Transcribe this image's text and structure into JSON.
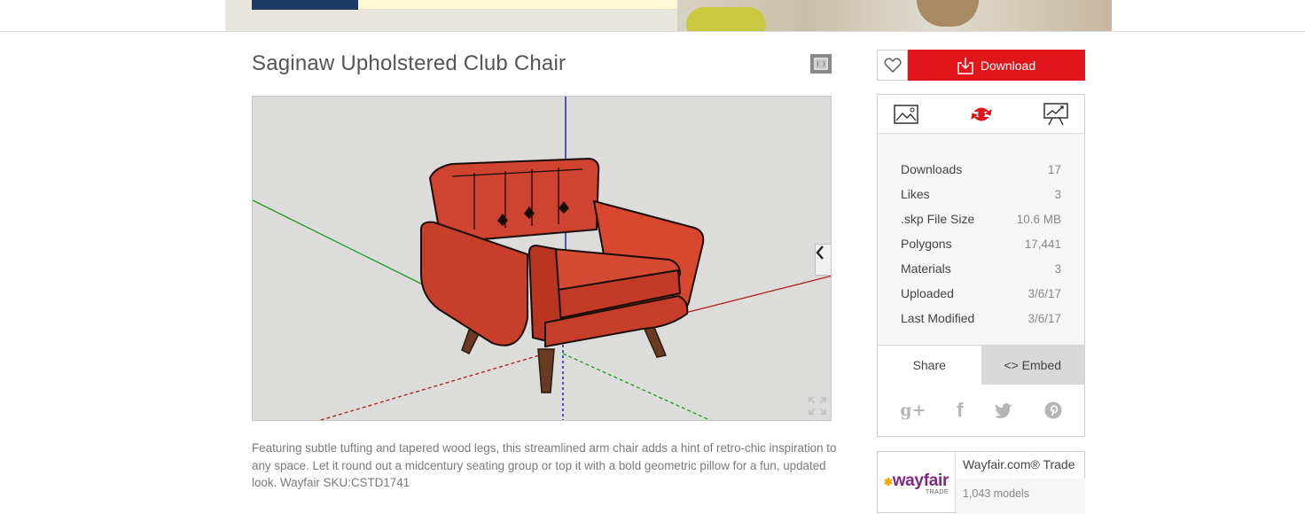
{
  "model": {
    "title": "Saginaw Upholstered Club Chair",
    "description": "Featuring subtle tufting and tapered wood legs, this streamlined arm chair adds a hint of retro-chic inspiration to any space. Let it round out a midcentury seating group or top it with a bold geometric pillow for a fun, updated look. Wayfair SKU:CSTD1741"
  },
  "actions": {
    "download_label": "Download",
    "like_icon": "heart-icon"
  },
  "view_tabs": [
    {
      "name": "image-view",
      "icon": "image-icon"
    },
    {
      "name": "3d-view",
      "icon": "3d-rotate-icon",
      "active": true
    },
    {
      "name": "presentation-view",
      "icon": "presentation-icon"
    }
  ],
  "stats": [
    {
      "label": "Downloads",
      "value": "17"
    },
    {
      "label": "Likes",
      "value": "3"
    },
    {
      "label": ".skp File Size",
      "value": "10.6 MB"
    },
    {
      "label": "Polygons",
      "value": "17,441"
    },
    {
      "label": "Materials",
      "value": "3"
    },
    {
      "label": "Uploaded",
      "value": "3/6/17"
    },
    {
      "label": "Last Modified",
      "value": "3/6/17"
    }
  ],
  "share": {
    "share_tab": "Share",
    "embed_tab": "<> Embed",
    "networks": [
      {
        "name": "google-plus",
        "glyph": "g+"
      },
      {
        "name": "facebook",
        "glyph": "f"
      },
      {
        "name": "twitter",
        "glyph": "t"
      },
      {
        "name": "pinterest",
        "glyph": "p"
      }
    ]
  },
  "author": {
    "name": "Wayfair.com® Trade",
    "count": "1,043 models",
    "logo_text": "wayfair",
    "logo_sub": "TRADE"
  },
  "colors": {
    "download_red": "#e0161c",
    "chair_red": "#d2432e",
    "axis_blue": "#1a1aa6",
    "axis_red": "#b31818",
    "axis_green": "#1a9a1a",
    "wayfair_purple": "#7b2a80"
  }
}
